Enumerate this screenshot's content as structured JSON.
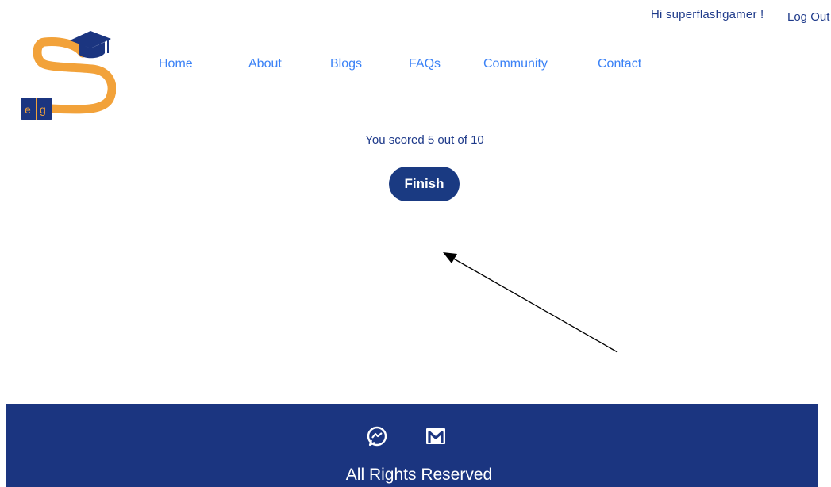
{
  "user": {
    "greeting": "Hi superflashgamer !",
    "logout_label": "Log Out"
  },
  "nav": {
    "items": [
      {
        "label": "Home"
      },
      {
        "label": "About"
      },
      {
        "label": "Blogs"
      },
      {
        "label": "FAQs"
      },
      {
        "label": "Community"
      },
      {
        "label": "Contact"
      }
    ]
  },
  "result": {
    "score_text": "You scored 5 out of 10",
    "finish_label": "Finish"
  },
  "footer": {
    "text": "All Rights Reserved",
    "icons": [
      "messenger-icon",
      "gmail-icon"
    ]
  },
  "colors": {
    "brand_navy": "#1b3580",
    "nav_blue": "#3b82f6",
    "logo_orange": "#f2a23a"
  }
}
